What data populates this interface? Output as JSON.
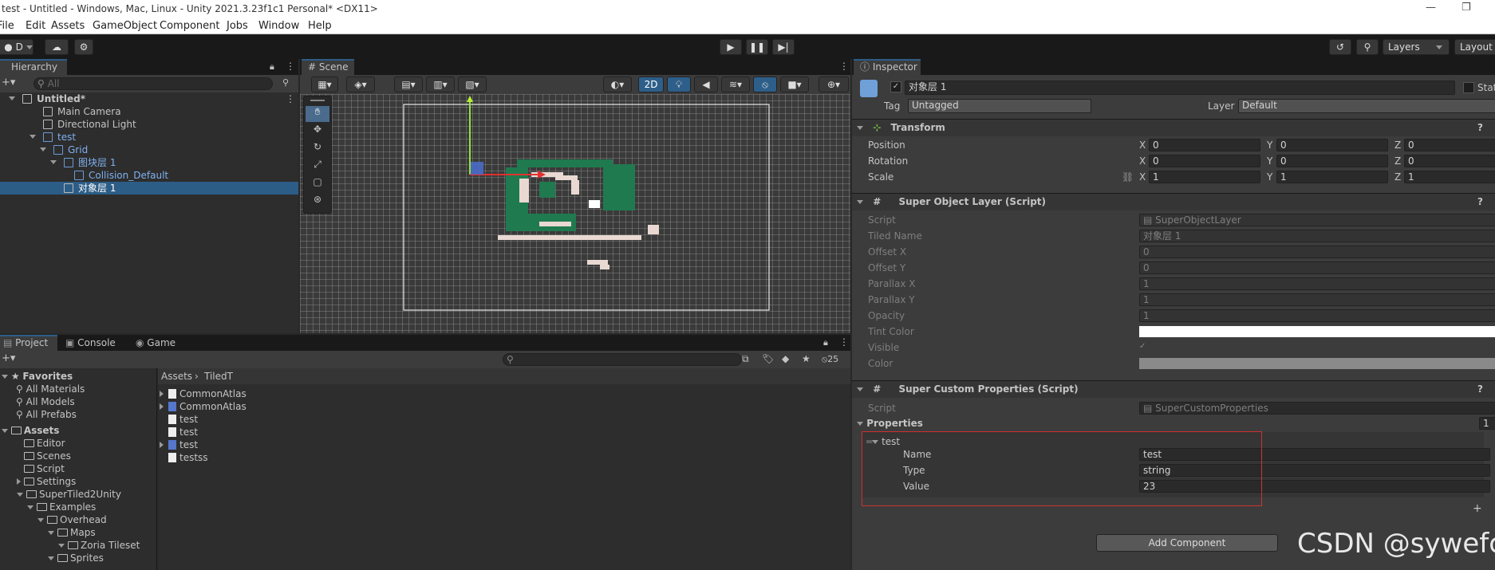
{
  "window": {
    "title": "test - Untitled - Windows, Mac, Linux - Unity 2021.3.23f1c1 Personal* <DX11>"
  },
  "menu": [
    "File",
    "Edit",
    "Assets",
    "GameObject",
    "Component",
    "Jobs",
    "Window",
    "Help"
  ],
  "toolbar": {
    "account": "D",
    "layers": "Layers",
    "layout": "Layout"
  },
  "hierarchy": {
    "tab": "Hierarchy",
    "search_placeholder": "All",
    "items": [
      {
        "label": "Untitled*",
        "depth": 0,
        "bold": true
      },
      {
        "label": "Main Camera",
        "depth": 2
      },
      {
        "label": "Directional Light",
        "depth": 2
      },
      {
        "label": "test",
        "depth": 2,
        "blue": true
      },
      {
        "label": "Grid",
        "depth": 3,
        "blue": true
      },
      {
        "label": "图块层 1",
        "depth": 4,
        "blue": true
      },
      {
        "label": "Collision_Default",
        "depth": 5,
        "blue": true
      },
      {
        "label": "对象层 1",
        "depth": 4,
        "selected": true
      }
    ]
  },
  "scene": {
    "tab": "Scene",
    "mode_2d": "2D"
  },
  "bottom_tabs": [
    "Project",
    "Console",
    "Game"
  ],
  "project": {
    "favorites_label": "Favorites",
    "favorites": [
      "All Materials",
      "All Models",
      "All Prefabs"
    ],
    "assets_label": "Assets",
    "tree": [
      {
        "label": "Editor",
        "depth": 1
      },
      {
        "label": "Scenes",
        "depth": 1
      },
      {
        "label": "Script",
        "depth": 1
      },
      {
        "label": "Settings",
        "depth": 1
      },
      {
        "label": "SuperTiled2Unity",
        "depth": 1
      },
      {
        "label": "Examples",
        "depth": 2
      },
      {
        "label": "Overhead",
        "depth": 3
      },
      {
        "label": "Maps",
        "depth": 4
      },
      {
        "label": "Zoria Tileset",
        "depth": 5
      },
      {
        "label": "Sprites",
        "depth": 4
      }
    ],
    "breadcrumb": [
      "Assets",
      "TiledT"
    ],
    "files": [
      "CommonAtlas",
      "CommonAtlas",
      "test",
      "test",
      "test",
      "testss"
    ],
    "hidden_count": "25"
  },
  "inspector": {
    "tab": "Inspector",
    "object_name": "对象层 1",
    "static_label": "Stat",
    "tag_label": "Tag",
    "tag_value": "Untagged",
    "layer_label": "Layer",
    "layer_value": "Default",
    "transform": {
      "title": "Transform",
      "rows": [
        {
          "label": "Position",
          "x": "0",
          "y": "0",
          "z": "0"
        },
        {
          "label": "Rotation",
          "x": "0",
          "y": "0",
          "z": "0"
        },
        {
          "label": "Scale",
          "x": "1",
          "y": "1",
          "z": "1"
        }
      ]
    },
    "sol": {
      "title": "Super Object Layer (Script)",
      "rows": [
        {
          "label": "Script",
          "value": "SuperObjectLayer"
        },
        {
          "label": "Tiled Name",
          "value": "对象层 1"
        },
        {
          "label": "Offset X",
          "value": "0"
        },
        {
          "label": "Offset Y",
          "value": "0"
        },
        {
          "label": "Parallax X",
          "value": "1"
        },
        {
          "label": "Parallax Y",
          "value": "1"
        },
        {
          "label": "Opacity",
          "value": "1"
        },
        {
          "label": "Tint Color",
          "value": ""
        },
        {
          "label": "Visible",
          "value": ""
        },
        {
          "label": "Color",
          "value": ""
        }
      ]
    },
    "scp": {
      "title": "Super Custom Properties (Script)",
      "script_label": "Script",
      "script_value": "SuperCustomProperties",
      "properties_label": "Properties",
      "properties_count": "1",
      "item_name": "test",
      "fields": [
        {
          "label": "Name",
          "value": "test"
        },
        {
          "label": "Type",
          "value": "string"
        },
        {
          "label": "Value",
          "value": "23"
        }
      ]
    },
    "add_component": "Add Component"
  },
  "watermark": "CSDN @sywefc",
  "colors": {
    "selection": "#2c5d87",
    "highlight_box": "#d03030",
    "tile_green": "#1f7a4f"
  }
}
